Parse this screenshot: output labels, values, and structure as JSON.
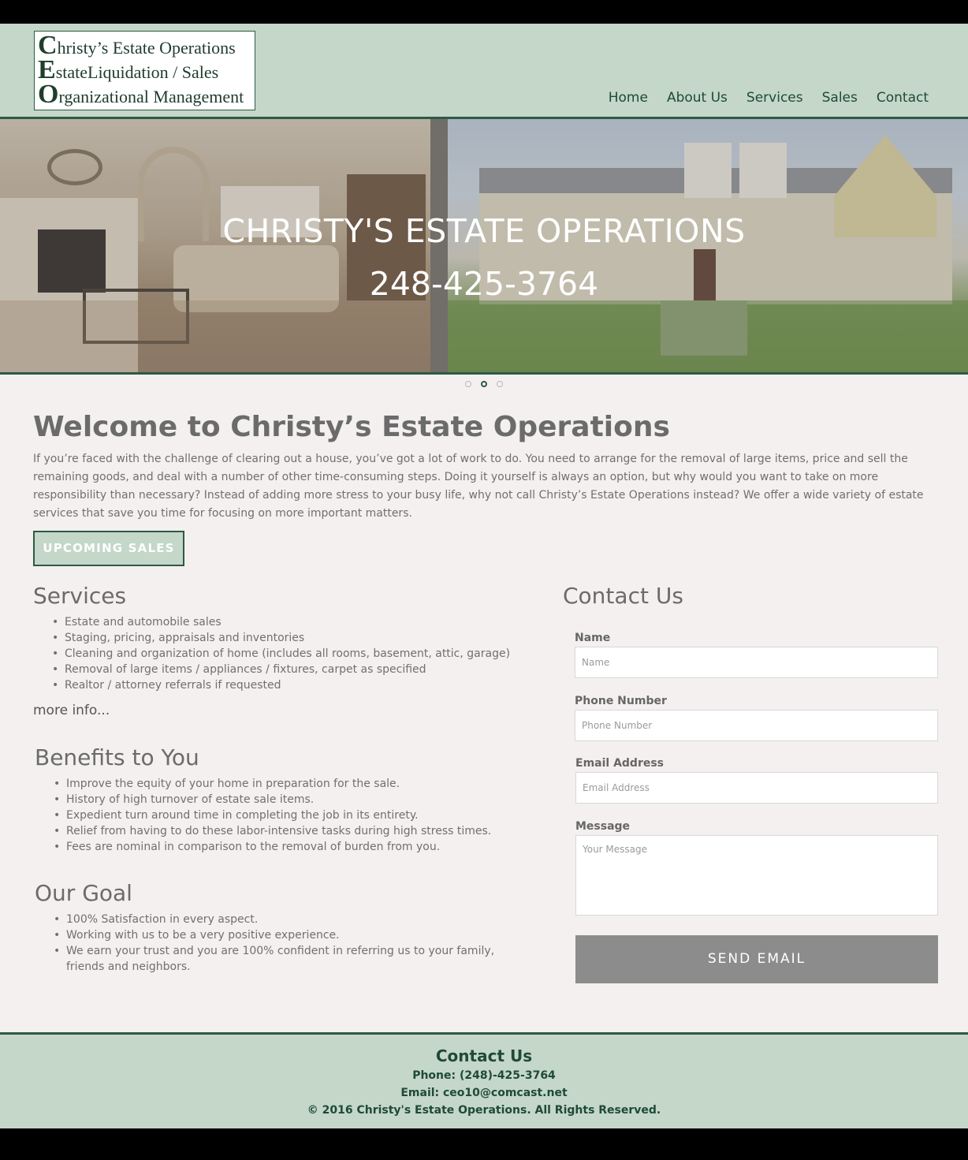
{
  "logo": {
    "line1_cap": "C",
    "line1_rest": "hristy’s Estate Operations",
    "line2_cap": "E",
    "line2_rest": "stateLiquidation / Sales",
    "line3_cap": "O",
    "line3_rest": "rganizational Management"
  },
  "nav": {
    "items": [
      {
        "label": "Home"
      },
      {
        "label": "About Us"
      },
      {
        "label": "Services"
      },
      {
        "label": "Sales"
      },
      {
        "label": "Contact"
      }
    ]
  },
  "hero": {
    "title": "CHRISTY'S ESTATE OPERATIONS",
    "phone": "248-425-3764",
    "slides_total": 3,
    "active_slide": 2
  },
  "welcome": {
    "title": "Welcome to Christy’s Estate Operations",
    "intro": "If you’re faced with the challenge of clearing out a house, you’ve got a lot of work to do. You need to arrange for the removal of large items, price and sell the remaining goods, and deal with a number of other time-consuming steps. Doing it yourself is always an option, but why would you want to take on more responsibility than necessary? Instead of adding more stress to your busy life, why not call Christy’s Estate Operations instead? We offer a wide variety of estate services that save you time for focusing on more important matters.",
    "button": "UPCOMING SALES"
  },
  "services": {
    "title": "Services",
    "items": [
      "Estate and automobile sales",
      "Staging, pricing, appraisals and inventories",
      "Cleaning and organization of home (includes all rooms, basement, attic, garage)",
      "Removal of large items / appliances / fixtures, carpet as specified",
      "Realtor / attorney referrals if requested"
    ],
    "more": "more info..."
  },
  "benefits": {
    "title": "Benefits to You",
    "items": [
      "Improve the equity of your home in preparation for the sale.",
      "History of high turnover of estate sale items.",
      "Expedient turn around time in completing the job in its entirety.",
      "Relief from having to do these labor-intensive tasks during high stress times.",
      "Fees are nominal in comparison to the removal of burden from you."
    ]
  },
  "goal": {
    "title": "Our Goal",
    "items": [
      "100% Satisfaction in every aspect.",
      "Working with us to be a very positive experience.",
      "We earn your trust and you are 100% confident in referring us to your family, friends and neighbors."
    ]
  },
  "contact_form": {
    "title": "Contact Us",
    "name_label": "Name",
    "name_placeholder": "Name",
    "phone_label": "Phone Number",
    "phone_placeholder": "Phone Number",
    "email_label": "Email Address",
    "email_placeholder": "Email Address",
    "message_label": "Message",
    "message_placeholder": "Your Message",
    "submit": "SEND EMAIL"
  },
  "footer": {
    "title": "Contact Us",
    "phone": "Phone: (248)-425-3764",
    "email": "Email: ceo10@comcast.net",
    "copyright": "© 2016 Christy's Estate Operations. All Rights Reserved."
  },
  "colors": {
    "header_bg": "#c4d7c8",
    "accent_dark_green": "#2e5a45",
    "page_bg": "#f3f0ef",
    "send_button": "#8c8c8c"
  }
}
